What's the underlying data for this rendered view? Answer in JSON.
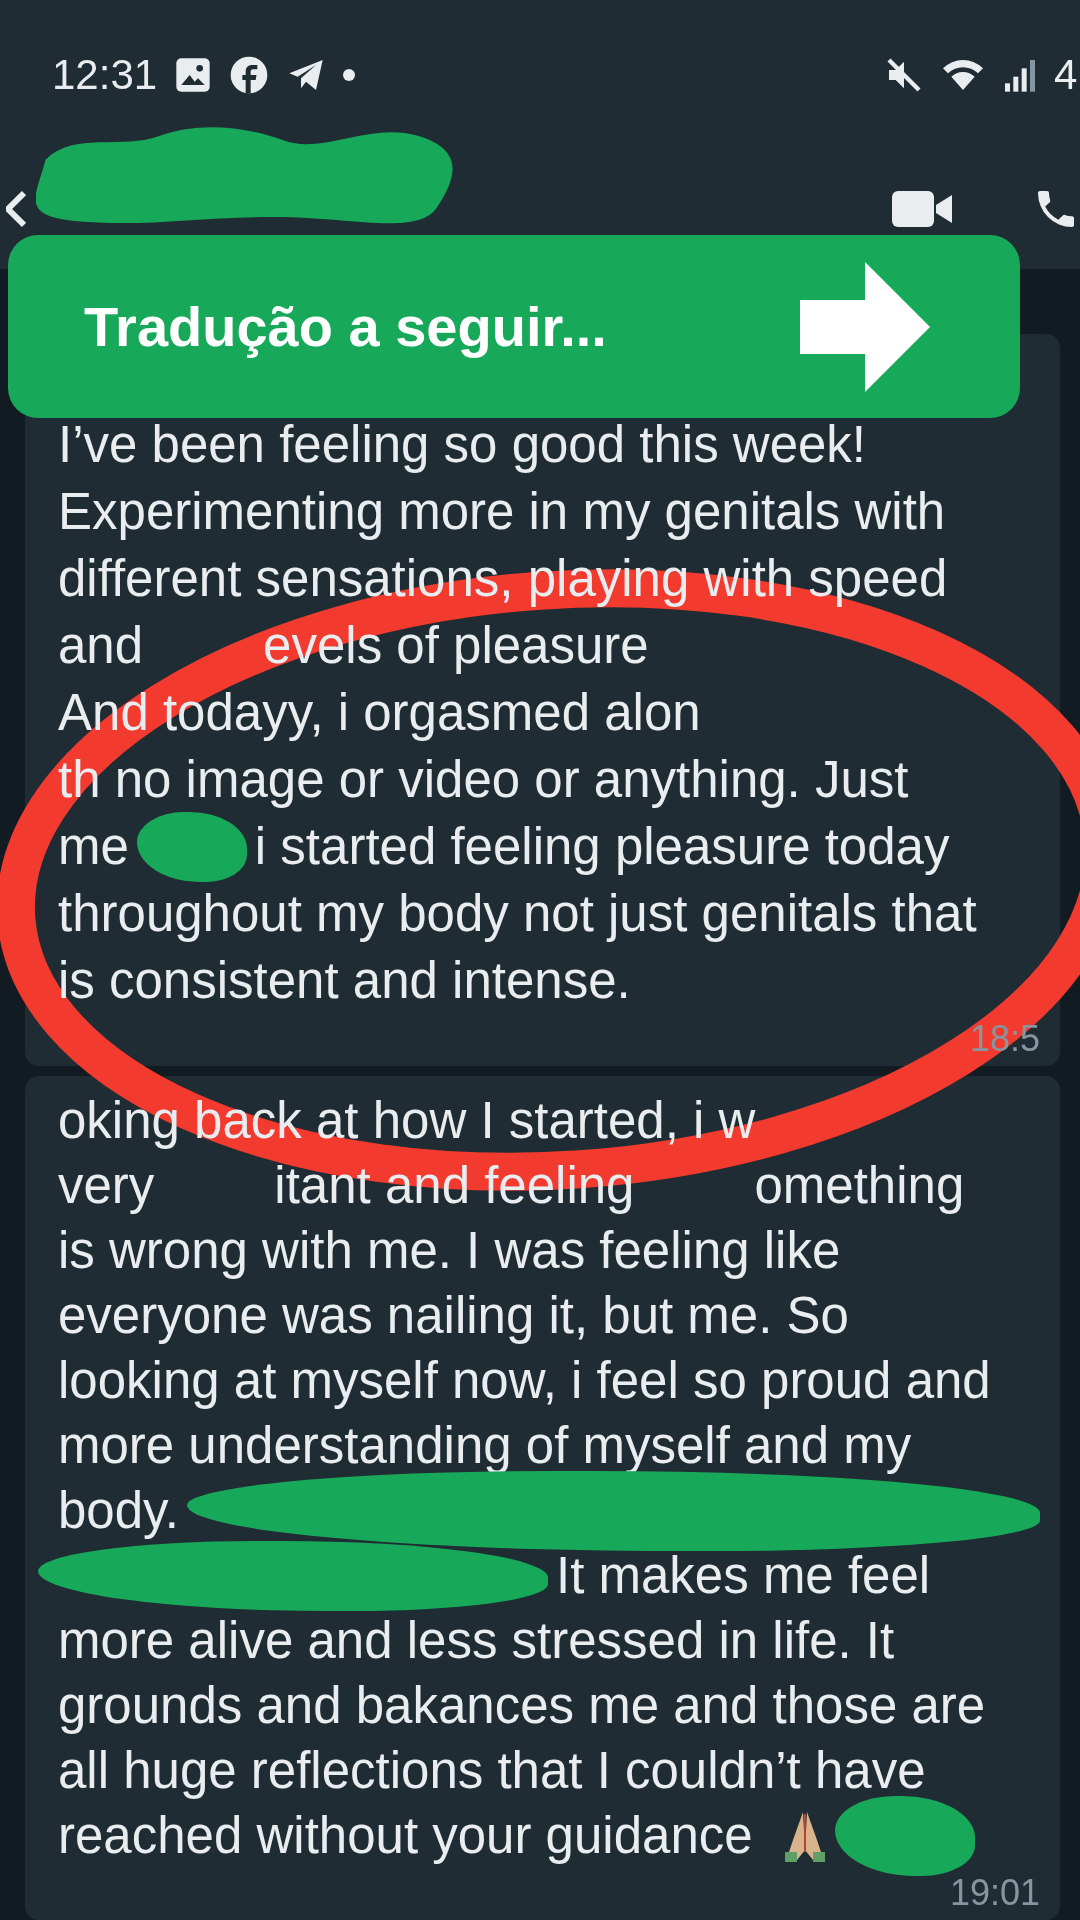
{
  "status_bar": {
    "time": "12:31",
    "battery": "4"
  },
  "header": {
    "name_redacted": true
  },
  "banner": {
    "text": "Tradução a seguir..."
  },
  "messages": [
    {
      "time": "18:5",
      "lines": [
        [
          {
            "kind": "text",
            "text": "I’ve been feeling so good this week!"
          }
        ],
        [
          {
            "kind": "text",
            "text": "Experimenting more in my genitals with"
          }
        ],
        [
          {
            "kind": "text",
            "text": "different sensations, playing with speed"
          }
        ],
        [
          {
            "kind": "text",
            "text": "and"
          },
          {
            "kind": "text",
            "text": "evels of pleasure"
          }
        ],
        [
          {
            "kind": "text",
            "text": "And todayy, i orgasmed alon"
          }
        ],
        [
          {
            "kind": "text",
            "text": "th no image or video or anything. Just"
          }
        ],
        [
          {
            "kind": "text",
            "text": "me"
          },
          {
            "kind": "redacted"
          },
          {
            "kind": "text",
            "text": "i started feeling pleasure today"
          }
        ],
        [
          {
            "kind": "text",
            "text": "throughout my body not just genitals that"
          }
        ],
        [
          {
            "kind": "text",
            "text": "is consistent and intense."
          }
        ]
      ]
    },
    {
      "time": "19:01",
      "lines": [
        [
          {
            "kind": "text",
            "text": "oking back at how I started, i w"
          }
        ],
        [
          {
            "kind": "text",
            "text": "very"
          },
          {
            "kind": "text",
            "text": "itant and feeling"
          },
          {
            "kind": "text",
            "text": "omething"
          }
        ],
        [
          {
            "kind": "text",
            "text": "is wrong with me. I was feeling like"
          }
        ],
        [
          {
            "kind": "text",
            "text": "everyone was nailing it, but me. So"
          }
        ],
        [
          {
            "kind": "text",
            "text": "looking at myself now, i feel so proud and"
          }
        ],
        [
          {
            "kind": "text",
            "text": "more understanding of myself and my"
          }
        ],
        [
          {
            "kind": "text",
            "text": "body."
          },
          {
            "kind": "redacted"
          }
        ],
        [
          {
            "kind": "redacted"
          },
          {
            "kind": "text",
            "text": "It makes me feel"
          }
        ],
        [
          {
            "kind": "text",
            "text": "more alive and less stressed in life. It"
          }
        ],
        [
          {
            "kind": "text",
            "text": "grounds and bakances me and those are"
          }
        ],
        [
          {
            "kind": "text",
            "text": "all huge reflections that I couldn’t have"
          }
        ],
        [
          {
            "kind": "text",
            "text": "reached without your guidance"
          },
          {
            "kind": "hands"
          },
          {
            "kind": "redacted"
          }
        ]
      ]
    }
  ]
}
